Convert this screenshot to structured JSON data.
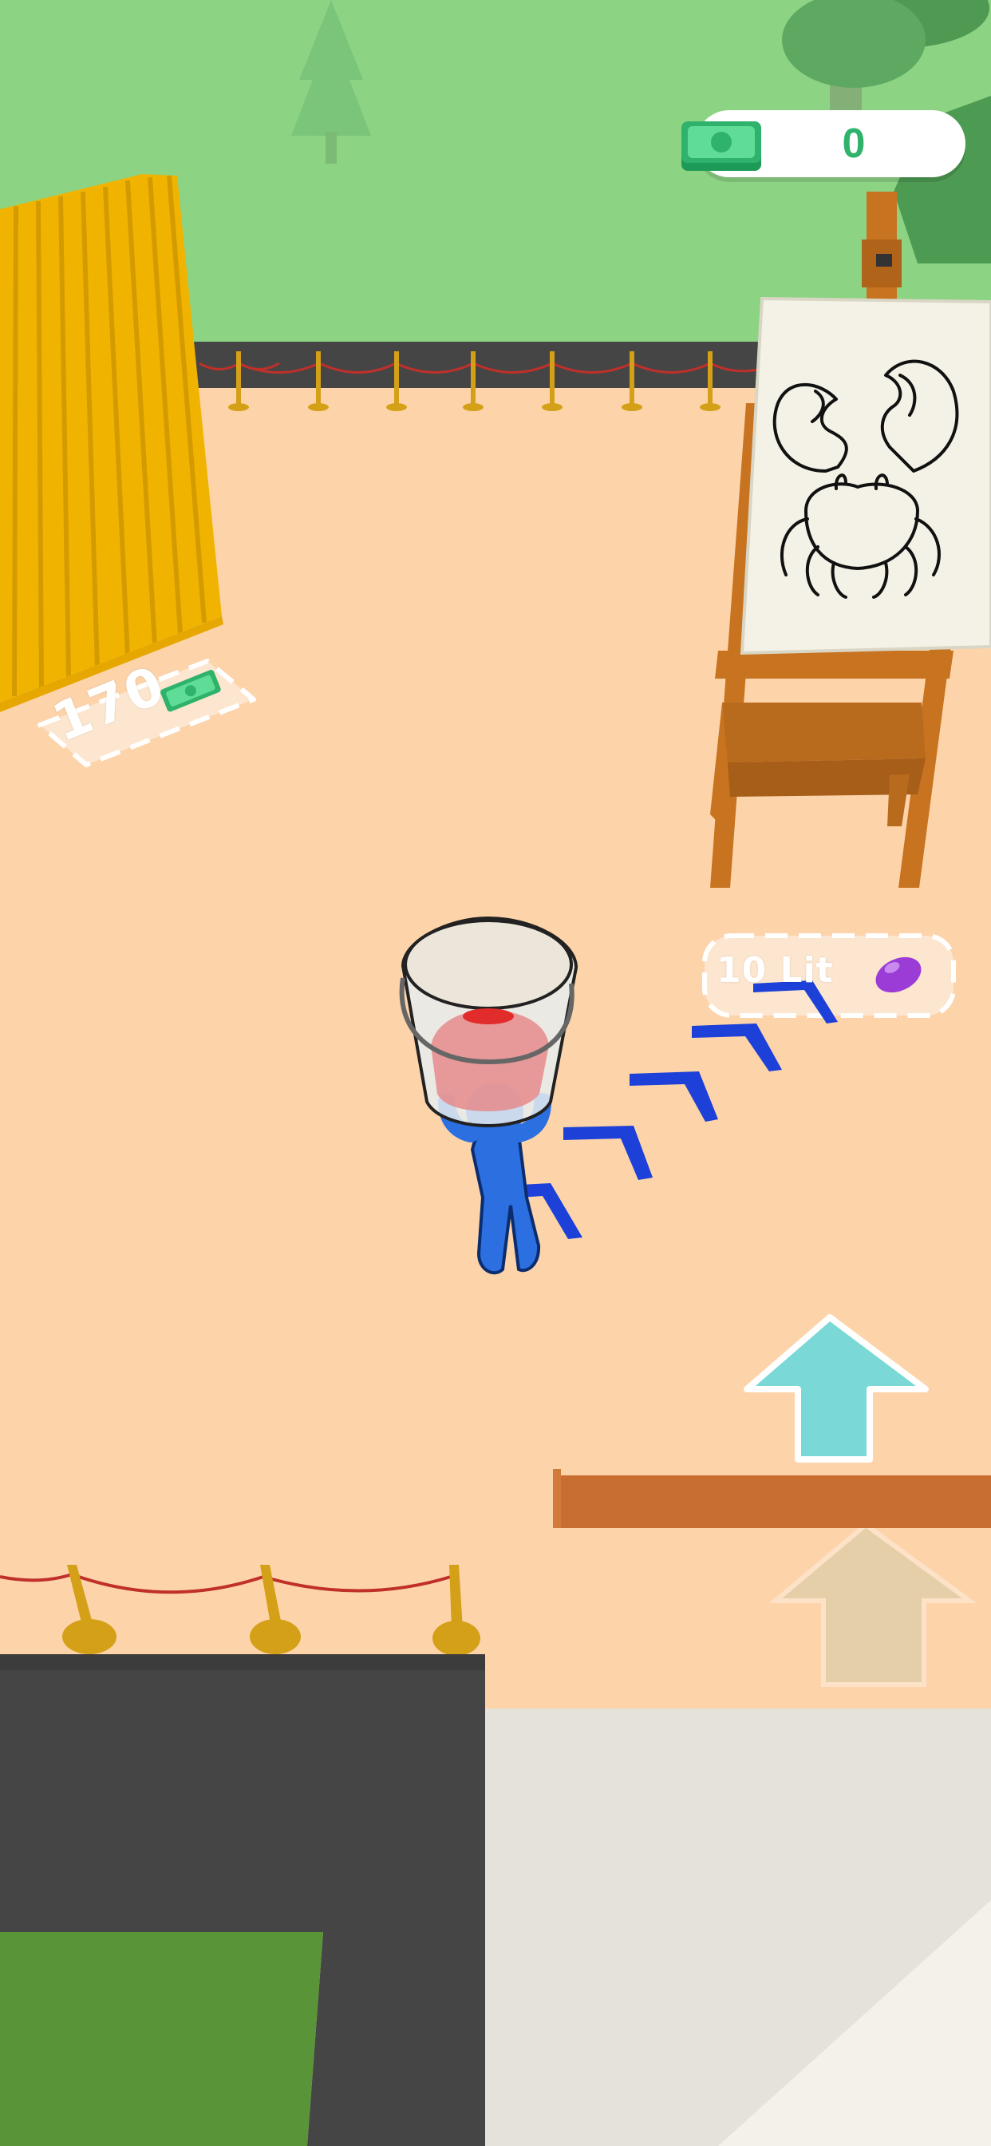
{
  "hud": {
    "money_count": "0",
    "money_icon": "cash-stack-icon"
  },
  "purchase_zones": {
    "fence_upgrade": {
      "price": "170",
      "icon": "cash-icon"
    },
    "paint_refill": {
      "amount": "10 Lit",
      "icon": "paint-drop-icon"
    }
  },
  "easel": {
    "drawing": "crab-outline"
  },
  "colors": {
    "floor": "#fdd3aa",
    "grass": "#8dd384",
    "player": "#2b6fe0",
    "guide_arrows": "#1c40d8",
    "action_arrow": "#7ad9d6",
    "cash": "#2fb36c",
    "fence_panels": "#f0b400",
    "rope": "#c0302a",
    "paint_drop": "#9b3cd6"
  }
}
